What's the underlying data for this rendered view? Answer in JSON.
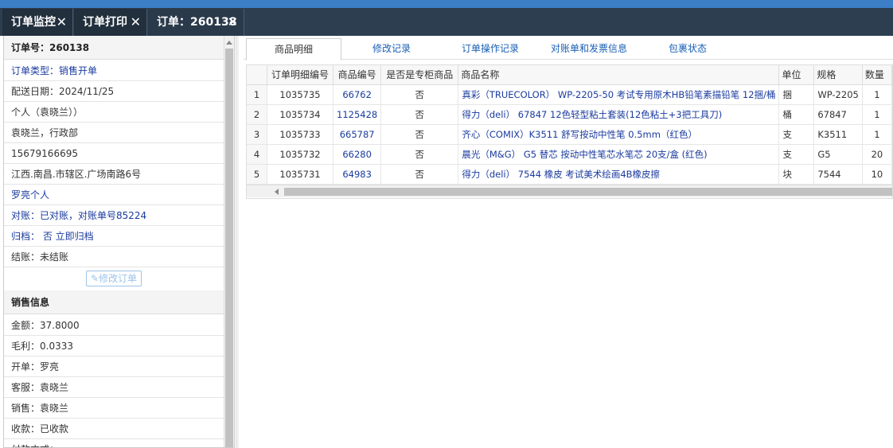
{
  "tabs": [
    {
      "label": "订单监控"
    },
    {
      "label": "订单打印"
    },
    {
      "label": "订单：260138"
    }
  ],
  "left": {
    "order_no": "订单号：260138",
    "rows": [
      "订单类型：销售开单",
      "配送日期：2024/11/25",
      "个人（袁晓兰））",
      "袁晓兰，行政部",
      "15679166695",
      "江西.南昌.市辖区.广场南路6号",
      "罗亮个人",
      "对账：已对账，对账单号85224",
      "归档： 否 立即归档",
      "结账：未结账"
    ],
    "edit_button": "修改订单",
    "sales_title": "销售信息",
    "sales_rows": [
      "金额：37.8000",
      "毛利：0.0333",
      "开单：罗亮",
      "客服：袁晓兰",
      "销售：袁晓兰",
      "收款：已收款",
      "付款方式："
    ]
  },
  "subtabs": [
    "商品明细",
    "修改记录",
    "订单操作记录",
    "对账单和发票信息",
    "包裹状态"
  ],
  "grid": {
    "headers": [
      "订单明细编号",
      "商品编号",
      "是否是专柜商品",
      "商品名称",
      "单位",
      "规格",
      "数量"
    ],
    "rows": [
      {
        "n": "1",
        "id": "1035735",
        "code": "66762",
        "special": "否",
        "name": "真彩（TRUECOLOR） WP-2205-50 考试专用原木HB铅笔素描铅笔 12捆/桶",
        "unit": "捆",
        "spec": "WP-2205",
        "qty": "1"
      },
      {
        "n": "2",
        "id": "1035734",
        "code": "1125428",
        "special": "否",
        "name": "得力（deli） 67847 12色轻型粘土套装(12色粘土+3把工具刀)",
        "unit": "桶",
        "spec": "67847",
        "qty": "1"
      },
      {
        "n": "3",
        "id": "1035733",
        "code": "665787",
        "special": "否",
        "name": "齐心（COMIX）K3511 舒写按动中性笔 0.5mm（红色）",
        "unit": "支",
        "spec": "K3511",
        "qty": "1"
      },
      {
        "n": "4",
        "id": "1035732",
        "code": "66280",
        "special": "否",
        "name": "晨光（M&G） G5 替芯 按动中性笔芯水笔芯 20支/盒 (红色)",
        "unit": "支",
        "spec": "G5",
        "qty": "20"
      },
      {
        "n": "5",
        "id": "1035731",
        "code": "64983",
        "special": "否",
        "name": "得力（deli） 7544 橡皮 考试美术绘画4B橡皮擦",
        "unit": "块",
        "spec": "7544",
        "qty": "10"
      }
    ]
  }
}
